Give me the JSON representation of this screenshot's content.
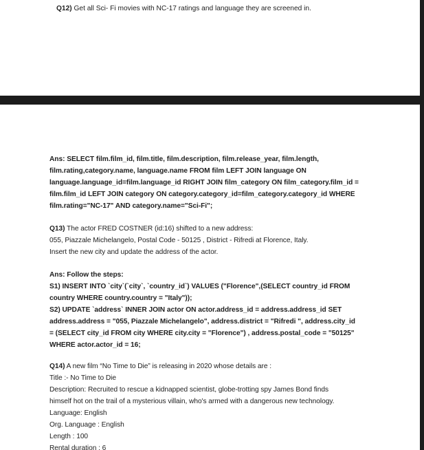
{
  "q12": {
    "number": "Q12)",
    "text": " Get all Sci- Fi movies with NC-17 ratings and language they are screened in."
  },
  "ans12": [
    "Ans: SELECT film.film_id, film.title, film.description, film.release_year, film.length,",
    "film.rating,category.name, language.name FROM film LEFT JOIN language ON",
    "language.language_id=film.language_id RIGHT JOIN film_category ON film_category.film_id =",
    "film.film_id LEFT JOIN category ON category.category_id=film_category.category_id  WHERE",
    "film.rating=\"NC-17\" AND category.name=\"Sci-Fi\";"
  ],
  "q13": {
    "number": "Q13)",
    "text": " The actor FRED COSTNER (id:16) shifted to a new address:",
    "line2": " 055,  Piazzale Michelangelo, Postal Code - 50125 , District - Rifredi at Florence, Italy.",
    "line3": "Insert the new city and update the address of the actor."
  },
  "ans13": [
    "Ans: Follow the steps:",
    "S1) INSERT INTO `city`(`city`, `country_id`) VALUES (\"Florence\",(SELECT country_id FROM",
    "country WHERE country.country = \"Italy\"));",
    "S2) UPDATE `address` INNER JOIN actor ON actor.address_id = address.address_id SET",
    "address.address = \"055,  Piazzale Michelangelo\", address.district = \"Rifredi \", address.city_id",
    "= (SELECT city_id FROM city WHERE city.city = \"Florence\") , address.postal_code = \"50125\"",
    "WHERE actor.actor_id = 16;"
  ],
  "q14": {
    "number": "Q14)",
    "text": " A new film “No Time to Die” is releasing in 2020 whose details are :",
    "details": [
      "Title :- No Time to Die",
      "Description: Recruited to rescue a kidnapped scientist, globe-trotting spy James Bond finds",
      "himself hot on the trail of a mysterious villain, who's armed with a dangerous new technology.",
      "Language: English",
      "Org. Language : English",
      "Length : 100",
      "Rental duration : 6"
    ]
  }
}
